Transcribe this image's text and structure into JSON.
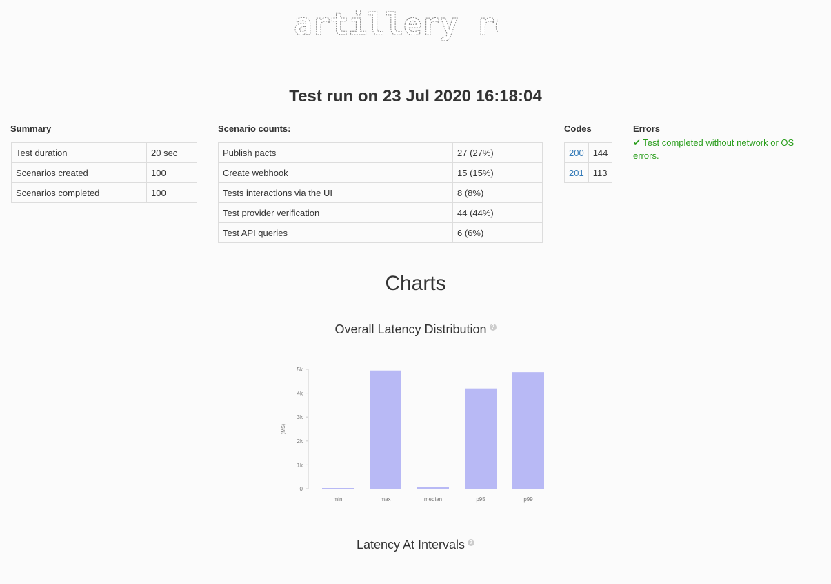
{
  "header": {
    "logo_text": "artillery report",
    "run_title": "Test run on 23 Jul 2020 16:18:04"
  },
  "summary": {
    "heading": "Summary",
    "rows": [
      {
        "label": "Test duration",
        "value": "20 sec"
      },
      {
        "label": "Scenarios created",
        "value": "100"
      },
      {
        "label": "Scenarios completed",
        "value": "100"
      }
    ]
  },
  "scenario_counts": {
    "heading": "Scenario counts:",
    "rows": [
      {
        "label": "Publish pacts",
        "value": "27 (27%)"
      },
      {
        "label": "Create webhook",
        "value": "15 (15%)"
      },
      {
        "label": "Tests interactions via the UI",
        "value": "8 (8%)"
      },
      {
        "label": "Test provider verification",
        "value": "44 (44%)"
      },
      {
        "label": "Test API queries",
        "value": "6 (6%)"
      }
    ]
  },
  "codes": {
    "heading": "Codes",
    "rows": [
      {
        "code": "200",
        "count": "144"
      },
      {
        "code": "201",
        "count": "113"
      }
    ]
  },
  "errors": {
    "heading": "Errors",
    "message": "✔ Test completed without network or OS errors."
  },
  "charts": {
    "heading": "Charts",
    "latency_distribution_title": "Overall Latency Distribution",
    "latency_intervals_title": "Latency At Intervals",
    "help_glyph": "?"
  },
  "chart_data": {
    "type": "bar",
    "title": "Overall Latency Distribution",
    "categories": [
      "min",
      "max",
      "median",
      "p95",
      "p99"
    ],
    "values": [
      10,
      4950,
      60,
      4200,
      4880
    ],
    "ylabel": "(MS)",
    "ylim": [
      0,
      5000
    ],
    "yticks": [
      0,
      1000,
      2000,
      3000,
      4000,
      5000
    ],
    "ytick_labels": [
      "0",
      "1k",
      "2k",
      "3k",
      "4k",
      "5k"
    ],
    "bar_color": "#b8b9f5",
    "grid": false
  }
}
